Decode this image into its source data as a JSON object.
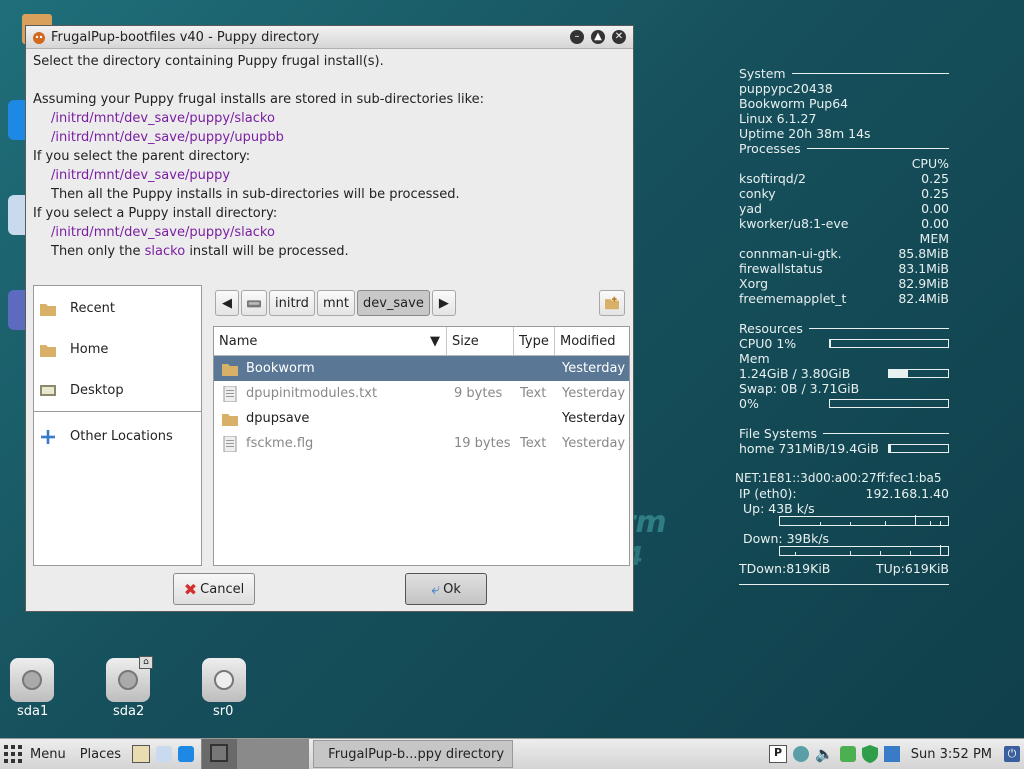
{
  "window": {
    "title": "FrugalPup-bootfiles v40 - Puppy directory",
    "controls": [
      "minimize",
      "maximize",
      "close"
    ]
  },
  "message": {
    "line1": "Select the directory containing Puppy frugal install(s).",
    "line2": "Assuming your Puppy frugal installs are stored in sub-directories like:",
    "path1": "/initrd/mnt/dev_save/puppy/slacko",
    "path2": "/initrd/mnt/dev_save/puppy/upupbb",
    "line3": "If you select the parent directory:",
    "path3": "/initrd/mnt/dev_save/puppy",
    "line4": "Then all the Puppy installs in sub-directories will be processed.",
    "line5": "If you select a Puppy install directory:",
    "path4": "/initrd/mnt/dev_save/puppy/slacko",
    "line6_pre": "Then only the ",
    "line6_word": "slacko",
    "line6_post": " install will be processed."
  },
  "places": [
    "Recent",
    "Home",
    "Desktop",
    "Other Locations"
  ],
  "pathbar": [
    "initrd",
    "mnt",
    "dev_save"
  ],
  "columns": {
    "name": "Name",
    "size": "Size",
    "type": "Type",
    "modified": "Modified"
  },
  "files": [
    {
      "name": "Bookworm",
      "size": "",
      "type": "",
      "modified": "Yesterday"
    },
    {
      "name": "dpupinitmodules.txt",
      "size": "9 bytes",
      "type": "Text",
      "modified": "Yesterday"
    },
    {
      "name": "dpupsave",
      "size": "",
      "type": "",
      "modified": "Yesterday"
    },
    {
      "name": "fsckme.flg",
      "size": "19 bytes",
      "type": "Text",
      "modified": "Yesterday"
    }
  ],
  "buttons": {
    "cancel": "Cancel",
    "ok": "Ok"
  },
  "conky": {
    "system": "System",
    "host": "puppypc20438",
    "distro": "Bookworm Pup64",
    "kernel": "Linux 6.1.27",
    "uptime": "Uptime 20h 38m 14s",
    "processes": "Processes",
    "cpu_head": "CPU%",
    "cpu_procs": [
      {
        "name": "ksoftirqd/2",
        "val": "0.25"
      },
      {
        "name": "conky",
        "val": "0.25"
      },
      {
        "name": "yad",
        "val": "0.00"
      },
      {
        "name": "kworker/u8:1-eve",
        "val": "0.00"
      }
    ],
    "mem_head": "MEM",
    "mem_procs": [
      {
        "name": "connman-ui-gtk.",
        "val": "85.8MiB"
      },
      {
        "name": "firewallstatus",
        "val": "83.1MiB"
      },
      {
        "name": "Xorg",
        "val": "82.9MiB"
      },
      {
        "name": "freememapplet_t",
        "val": "82.4MiB"
      }
    ],
    "resources": "Resources",
    "cpu0": "CPU0 1%",
    "cpu0_level": 0.01,
    "mem": "Mem",
    "mem_val": "1.24GiB / 3.80GiB",
    "mem_level": 0.33,
    "swap": "Swap: 0B / 3.71GiB",
    "swap_pct": "0%",
    "swap_level": 0,
    "filesystems": "File Systems",
    "home": "home 731MiB/19.4GiB",
    "home_level": 0.04,
    "net_overlap": "NET:1E81::3d00:a00:27ff:fec1:ba5",
    "ip_label": "IP (eth0):",
    "ip": "192.168.1.40",
    "up": "Up: 43B k/s",
    "down": "Down: 39Bk/s",
    "tdown": "TDown:819KiB",
    "tup": "TUp:619KiB"
  },
  "desktop": {
    "drives": [
      "sda1",
      "sda2",
      "sr0"
    ],
    "watermark1": "orm",
    "watermark2": "4"
  },
  "taskbar": {
    "menu": "Menu",
    "places": "Places",
    "task": "FrugalPup-b...ppy directory",
    "clock": "Sun  3:52 PM"
  },
  "colors": {
    "selection": "#5a7896",
    "path_purple": "#7b1fa2",
    "desktop": "#16505c"
  }
}
